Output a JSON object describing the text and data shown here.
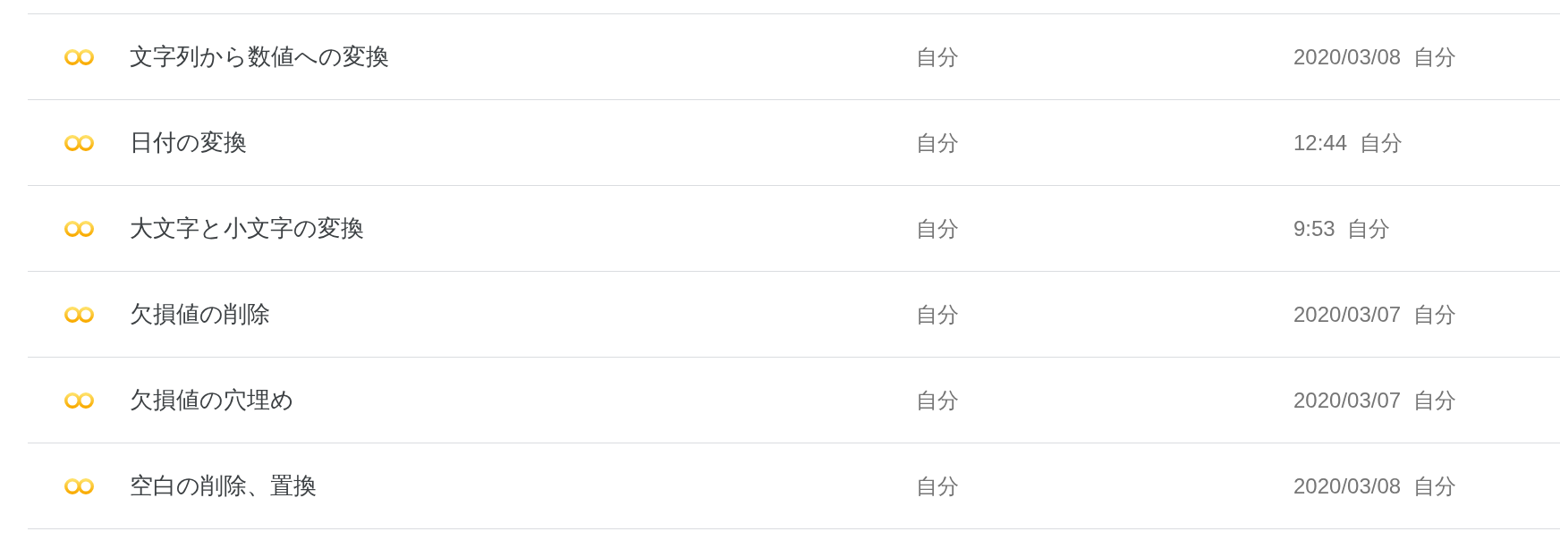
{
  "files": [
    {
      "name": "文字列から数値への変換",
      "column_2": "自分",
      "column_3": "2020/03/08 自分"
    },
    {
      "name": "日付の変換",
      "column_2": "自分",
      "column_3": "12:44 自分"
    },
    {
      "name": "大文字と小文字の変換",
      "column_2": "自分",
      "column_3": "9:53 自分"
    },
    {
      "name": "欠損値の削除",
      "column_2": "自分",
      "column_3": "2020/03/07 自分"
    },
    {
      "name": "欠損値の穴埋め",
      "column_2": "自分",
      "column_3": "2020/03/07 自分"
    },
    {
      "name": "空白の削除、置換",
      "column_2": "自分",
      "column_3": "2020/03/08 自分"
    }
  ]
}
